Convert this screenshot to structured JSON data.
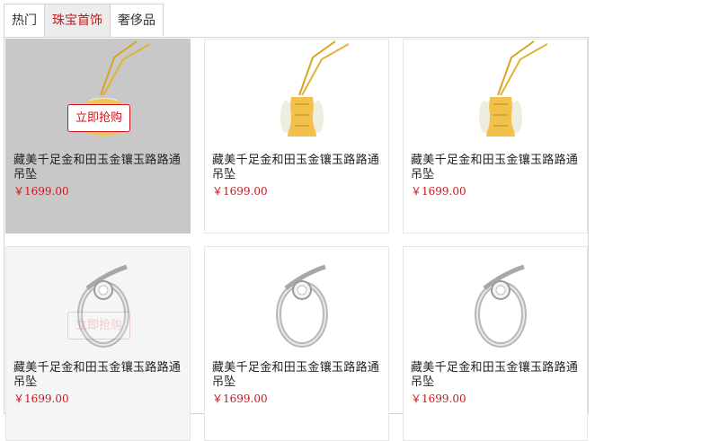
{
  "tabs": [
    {
      "label": "热门",
      "active": false
    },
    {
      "label": "珠宝首饰",
      "active": true
    },
    {
      "label": "奢侈品",
      "active": false
    }
  ],
  "products": [
    {
      "name": "藏美千足金和田玉金镶玉路路通吊坠",
      "price": "￥1699.00",
      "image": "jade-pendant",
      "hover": true
    },
    {
      "name": "藏美千足金和田玉金镶玉路路通吊坠",
      "price": "￥1699.00",
      "image": "jade-pendant",
      "hover": false
    },
    {
      "name": "藏美千足金和田玉金镶玉路路通吊坠",
      "price": "￥1699.00",
      "image": "jade-pendant",
      "hover": false
    },
    {
      "name": "藏美千足金和田玉金镶玉路路通吊坠",
      "price": "￥1699.00",
      "image": "diamond-ring",
      "hover": false
    },
    {
      "name": "藏美千足金和田玉金镶玉路路通吊坠",
      "price": "￥1699.00",
      "image": "diamond-ring",
      "hover": false
    },
    {
      "name": "藏美千足金和田玉金镶玉路路通吊坠",
      "price": "￥1699.00",
      "image": "diamond-ring",
      "hover": false
    }
  ],
  "buy_button_label": "立即抢购",
  "colors": {
    "accent": "#c8181d",
    "hover_overlay": "#c8c8c8",
    "border": "#d4d4d4"
  }
}
